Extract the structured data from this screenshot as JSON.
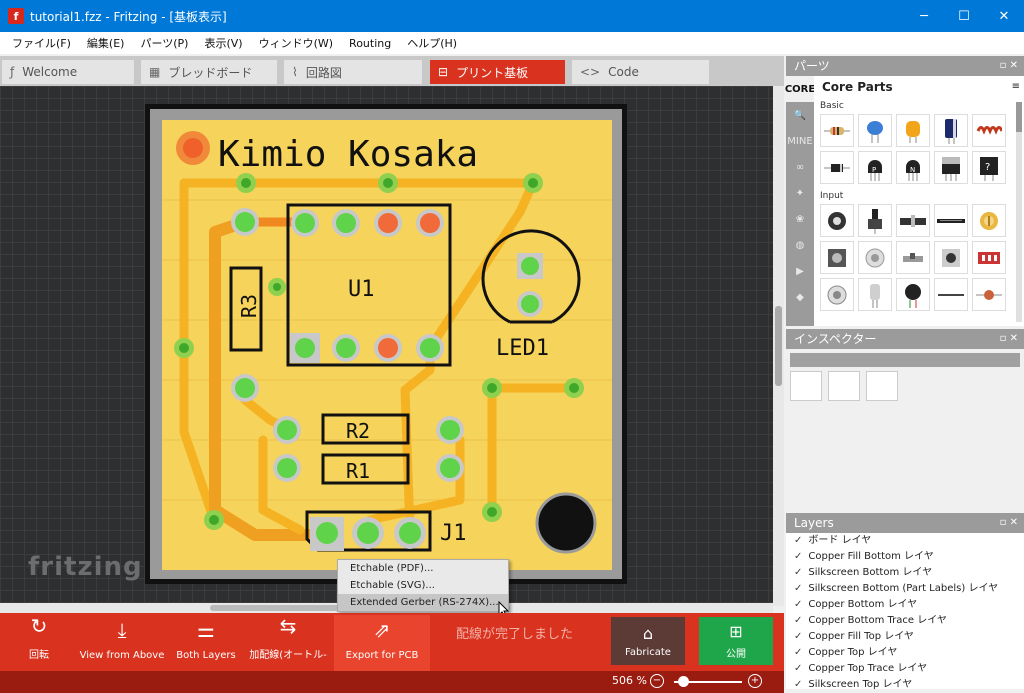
{
  "window": {
    "title": "tutorial1.fzz - Fritzing - [基板表示]",
    "app_icon": "f"
  },
  "menu": [
    "ファイル(F)",
    "編集(E)",
    "パーツ(P)",
    "表示(V)",
    "ウィンドウ(W)",
    "Routing",
    "ヘルプ(H)"
  ],
  "tabs": [
    {
      "label": "Welcome",
      "icon": "fritzing-icon",
      "active": false
    },
    {
      "label": "ブレッドボード",
      "icon": "breadboard-icon",
      "active": false
    },
    {
      "label": "回路図",
      "icon": "schematic-icon",
      "active": false
    },
    {
      "label": "プリント基板",
      "icon": "pcb-icon",
      "active": true
    },
    {
      "label": "Code",
      "icon": "code-icon",
      "active": false
    }
  ],
  "pcb": {
    "silkscreen_title": "Kimio Kosaka",
    "labels": {
      "u1": "U1",
      "r3": "R3",
      "r2": "R2",
      "r1": "R1",
      "led1": "LED1",
      "j1": "J1"
    }
  },
  "watermark": "fritzing",
  "context_menu": {
    "items": [
      "Etchable (PDF)...",
      "Etchable (SVG)...",
      "Extended Gerber (RS-274X)..."
    ],
    "highlighted": 2
  },
  "toolbar": {
    "rotate": "回転",
    "view_from_above": "View from Above",
    "both_layers": "Both Layers",
    "autoroute": "加配線(オートル-",
    "export_pcb": "Export for PCB",
    "status": "配線が完了しました",
    "fabricate": "Fabricate",
    "share": "公開"
  },
  "statusbar": {
    "zoom": "506 %"
  },
  "parts_panel": {
    "title": "パーツ",
    "bin_title": "Core Parts",
    "side": [
      "CORE",
      "search-icon",
      "MINE",
      "arduino-icon",
      "sparkfun-icon",
      "seeed-icon",
      "intel-icon",
      "play-icon",
      "more-icon"
    ],
    "categories": [
      "Basic",
      "Input"
    ]
  },
  "inspector": {
    "title": "インスペクター"
  },
  "layers": {
    "title": "Layers",
    "items": [
      "ボード レイヤ",
      "Copper Fill Bottom レイヤ",
      "Silkscreen Bottom レイヤ",
      "Silkscreen Bottom (Part Labels) レイヤ",
      "Copper Bottom レイヤ",
      "Copper Bottom Trace レイヤ",
      "Copper Fill Top レイヤ",
      "Copper Top レイヤ",
      "Copper Top Trace レイヤ",
      "Silkscreen Top レイヤ"
    ]
  },
  "colors": {
    "accent": "#d9321f",
    "board": "#f4c542",
    "trace": "#f5b323",
    "pad_green": "#5fd34a",
    "fab_dark": "#5c3a36",
    "share_green": "#1fa64a",
    "titlebar": "#0078d7"
  }
}
